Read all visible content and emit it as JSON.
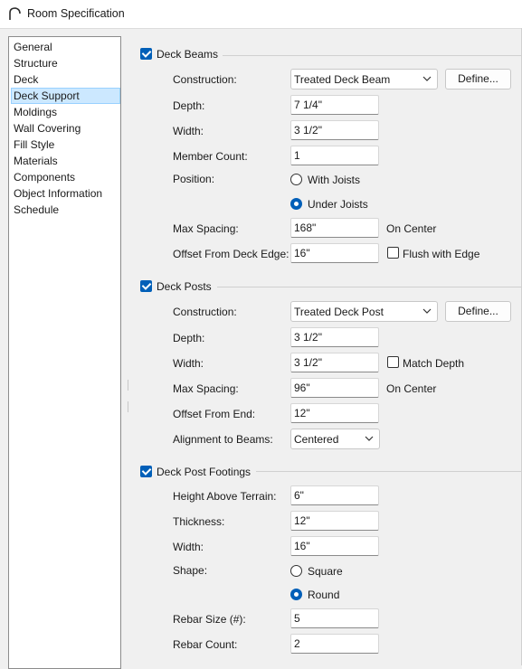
{
  "window": {
    "title": "Room Specification"
  },
  "sidebar": {
    "items": [
      {
        "label": "General"
      },
      {
        "label": "Structure"
      },
      {
        "label": "Deck"
      },
      {
        "label": "Deck Support",
        "selected": true
      },
      {
        "label": "Moldings"
      },
      {
        "label": "Wall Covering"
      },
      {
        "label": "Fill Style"
      },
      {
        "label": "Materials"
      },
      {
        "label": "Components"
      },
      {
        "label": "Object Information"
      },
      {
        "label": "Schedule"
      }
    ]
  },
  "deck_beams": {
    "title": "Deck Beams",
    "checked": true,
    "construction_label": "Construction:",
    "construction_value": "Treated Deck Beam",
    "define_label": "Define...",
    "depth_label": "Depth:",
    "depth_value": "7 1/4\"",
    "width_label": "Width:",
    "width_value": "3 1/2\"",
    "member_count_label": "Member Count:",
    "member_count_value": "1",
    "position_label": "Position:",
    "position_option_1": "With Joists",
    "position_option_2": "Under Joists",
    "position_selected": "Under Joists",
    "max_spacing_label": "Max Spacing:",
    "max_spacing_value": "168\"",
    "max_spacing_unit": "On Center",
    "offset_label": "Offset From Deck Edge:",
    "offset_value": "16\"",
    "flush_label": "Flush with Edge",
    "flush_checked": false
  },
  "deck_posts": {
    "title": "Deck Posts",
    "checked": true,
    "construction_label": "Construction:",
    "construction_value": "Treated Deck Post",
    "define_label": "Define...",
    "depth_label": "Depth:",
    "depth_value": "3 1/2\"",
    "width_label": "Width:",
    "width_value": "3 1/2\"",
    "match_depth_label": "Match Depth",
    "match_depth_checked": false,
    "max_spacing_label": "Max Spacing:",
    "max_spacing_value": "96\"",
    "max_spacing_unit": "On Center",
    "offset_label": "Offset From End:",
    "offset_value": "12\"",
    "alignment_label": "Alignment to Beams:",
    "alignment_value": "Centered"
  },
  "footings": {
    "title": "Deck Post Footings",
    "checked": true,
    "height_label": "Height Above Terrain:",
    "height_value": "6\"",
    "thickness_label": "Thickness:",
    "thickness_value": "12\"",
    "width_label": "Width:",
    "width_value": "16\"",
    "shape_label": "Shape:",
    "shape_option_1": "Square",
    "shape_option_2": "Round",
    "shape_selected": "Round",
    "rebar_size_label": "Rebar Size (#):",
    "rebar_size_value": "5",
    "rebar_count_label": "Rebar Count:",
    "rebar_count_value": "2"
  },
  "colors": {
    "accent": "#005fb8",
    "selection": "#cce8ff"
  }
}
